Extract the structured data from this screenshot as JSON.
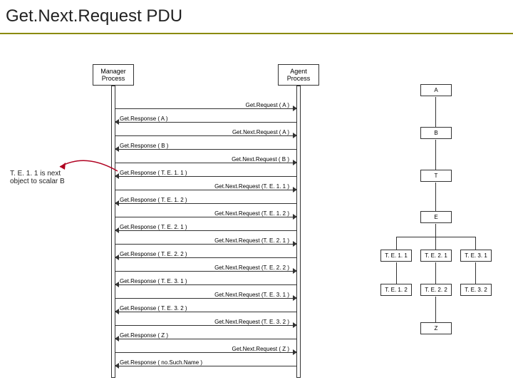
{
  "title": "Get.Next.Request PDU",
  "manager_label": "Manager Process",
  "agent_label": "Agent Process",
  "note": "T. E. 1. 1 is next object to scalar B",
  "msgs": [
    {
      "dir": "r",
      "label": "Get.Request ( A )"
    },
    {
      "dir": "l",
      "label": "Get.Response ( A )"
    },
    {
      "dir": "r",
      "label": "Get.Next.Request ( A )"
    },
    {
      "dir": "l",
      "label": "Get.Response ( B )"
    },
    {
      "dir": "r",
      "label": "Get.Next.Request ( B )"
    },
    {
      "dir": "l",
      "label": "Get.Response ( T. E. 1. 1 )"
    },
    {
      "dir": "r",
      "label": "Get.Next.Request (T. E. 1. 1 )"
    },
    {
      "dir": "l",
      "label": "Get.Response ( T. E. 1. 2 )"
    },
    {
      "dir": "r",
      "label": "Get.Next.Request (T. E. 1. 2 )"
    },
    {
      "dir": "l",
      "label": "Get.Response ( T. E. 2. 1 )"
    },
    {
      "dir": "r",
      "label": "Get.Next.Request (T. E. 2. 1 )"
    },
    {
      "dir": "l",
      "label": "Get.Response ( T. E. 2. 2 )"
    },
    {
      "dir": "r",
      "label": "Get.Next.Request (T. E. 2. 2 )"
    },
    {
      "dir": "l",
      "label": "Get.Response ( T. E. 3. 1 )"
    },
    {
      "dir": "r",
      "label": "Get.Next.Request (T. E. 3. 1 )"
    },
    {
      "dir": "l",
      "label": "Get.Response ( T. E. 3. 2 )"
    },
    {
      "dir": "r",
      "label": "Get.Next.Request (T. E. 3. 2 )"
    },
    {
      "dir": "l",
      "label": "Get.Response ( Z )"
    },
    {
      "dir": "r",
      "label": "Get.Next.Request ( Z )"
    },
    {
      "dir": "l",
      "label": "Get.Response ( no.Such.Name )"
    }
  ],
  "tree": {
    "A": "A",
    "B": "B",
    "T": "T",
    "E": "E",
    "Z": "Z",
    "r1": [
      "T. E. 1. 1",
      "T. E. 2. 1",
      "T. E. 3. 1"
    ],
    "r2": [
      "T. E. 1. 2",
      "T. E. 2. 2",
      "T. E. 3. 2"
    ]
  }
}
